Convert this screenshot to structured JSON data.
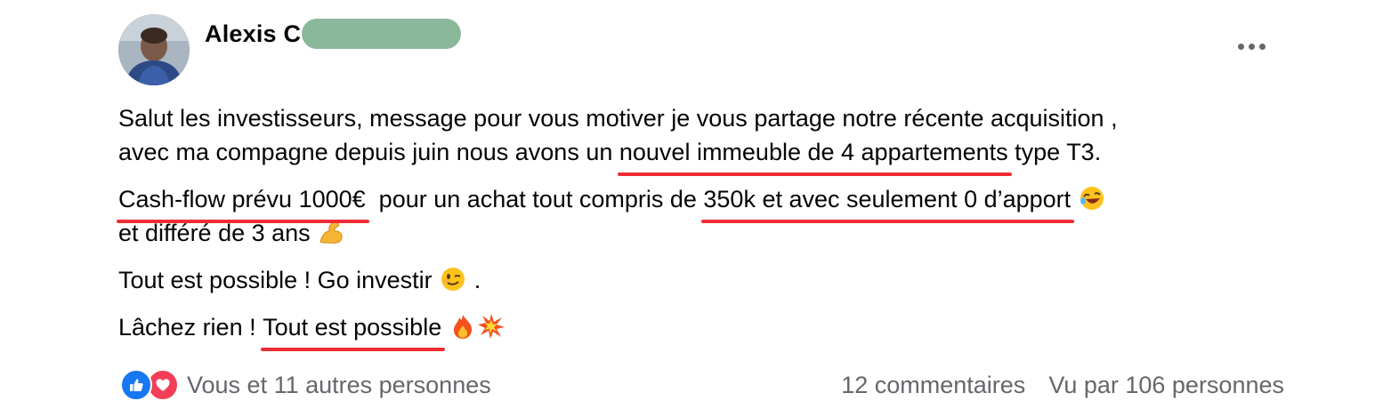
{
  "post": {
    "author": {
      "name": "Alexis C",
      "redaction_color": "#8ab89a"
    },
    "more_icon": "more-horizontal-icon",
    "paragraphs": {
      "p1": {
        "line1": "Salut les investisseurs, message pour vous motiver je vous partage notre récente acquisition ,",
        "line2_before": "avec ma compagne depuis juin nous avons un ",
        "line2_underlined": "nouvel immeuble de 4 appartements",
        "line2_after": " type T3."
      },
      "p2": {
        "underlined1": "Cash-flow prévu 1000€",
        "middle": "  pour un achat tout compris de ",
        "underlined2": "350k et avec seulement 0 d’apport",
        "emoji1": "rolling-on-floor-laughing-emoji",
        "line2": "et différé de 3 ans",
        "emoji2": "flexed-biceps-emoji"
      },
      "p3": {
        "text": "Tout est possible ! Go investir",
        "emoji": "winking-face-emoji",
        "after": " ."
      },
      "p4": {
        "before": "Lâchez rien ! ",
        "underlined": "Tout est possible",
        "emoji1": "fire-emoji",
        "emoji2": "collision-emoji"
      }
    },
    "underline_color": "#ee2d35",
    "footer": {
      "reaction_icons": [
        "like-icon",
        "love-icon"
      ],
      "reactions_label": "Vous et 11 autres personnes",
      "comments_label": "12 commentaires",
      "views_label": "Vu par 106 personnes"
    }
  },
  "colors": {
    "text": "#050505",
    "secondary_text": "#65676b",
    "like_blue": "#1877f2",
    "love_red": "#f33e58"
  }
}
